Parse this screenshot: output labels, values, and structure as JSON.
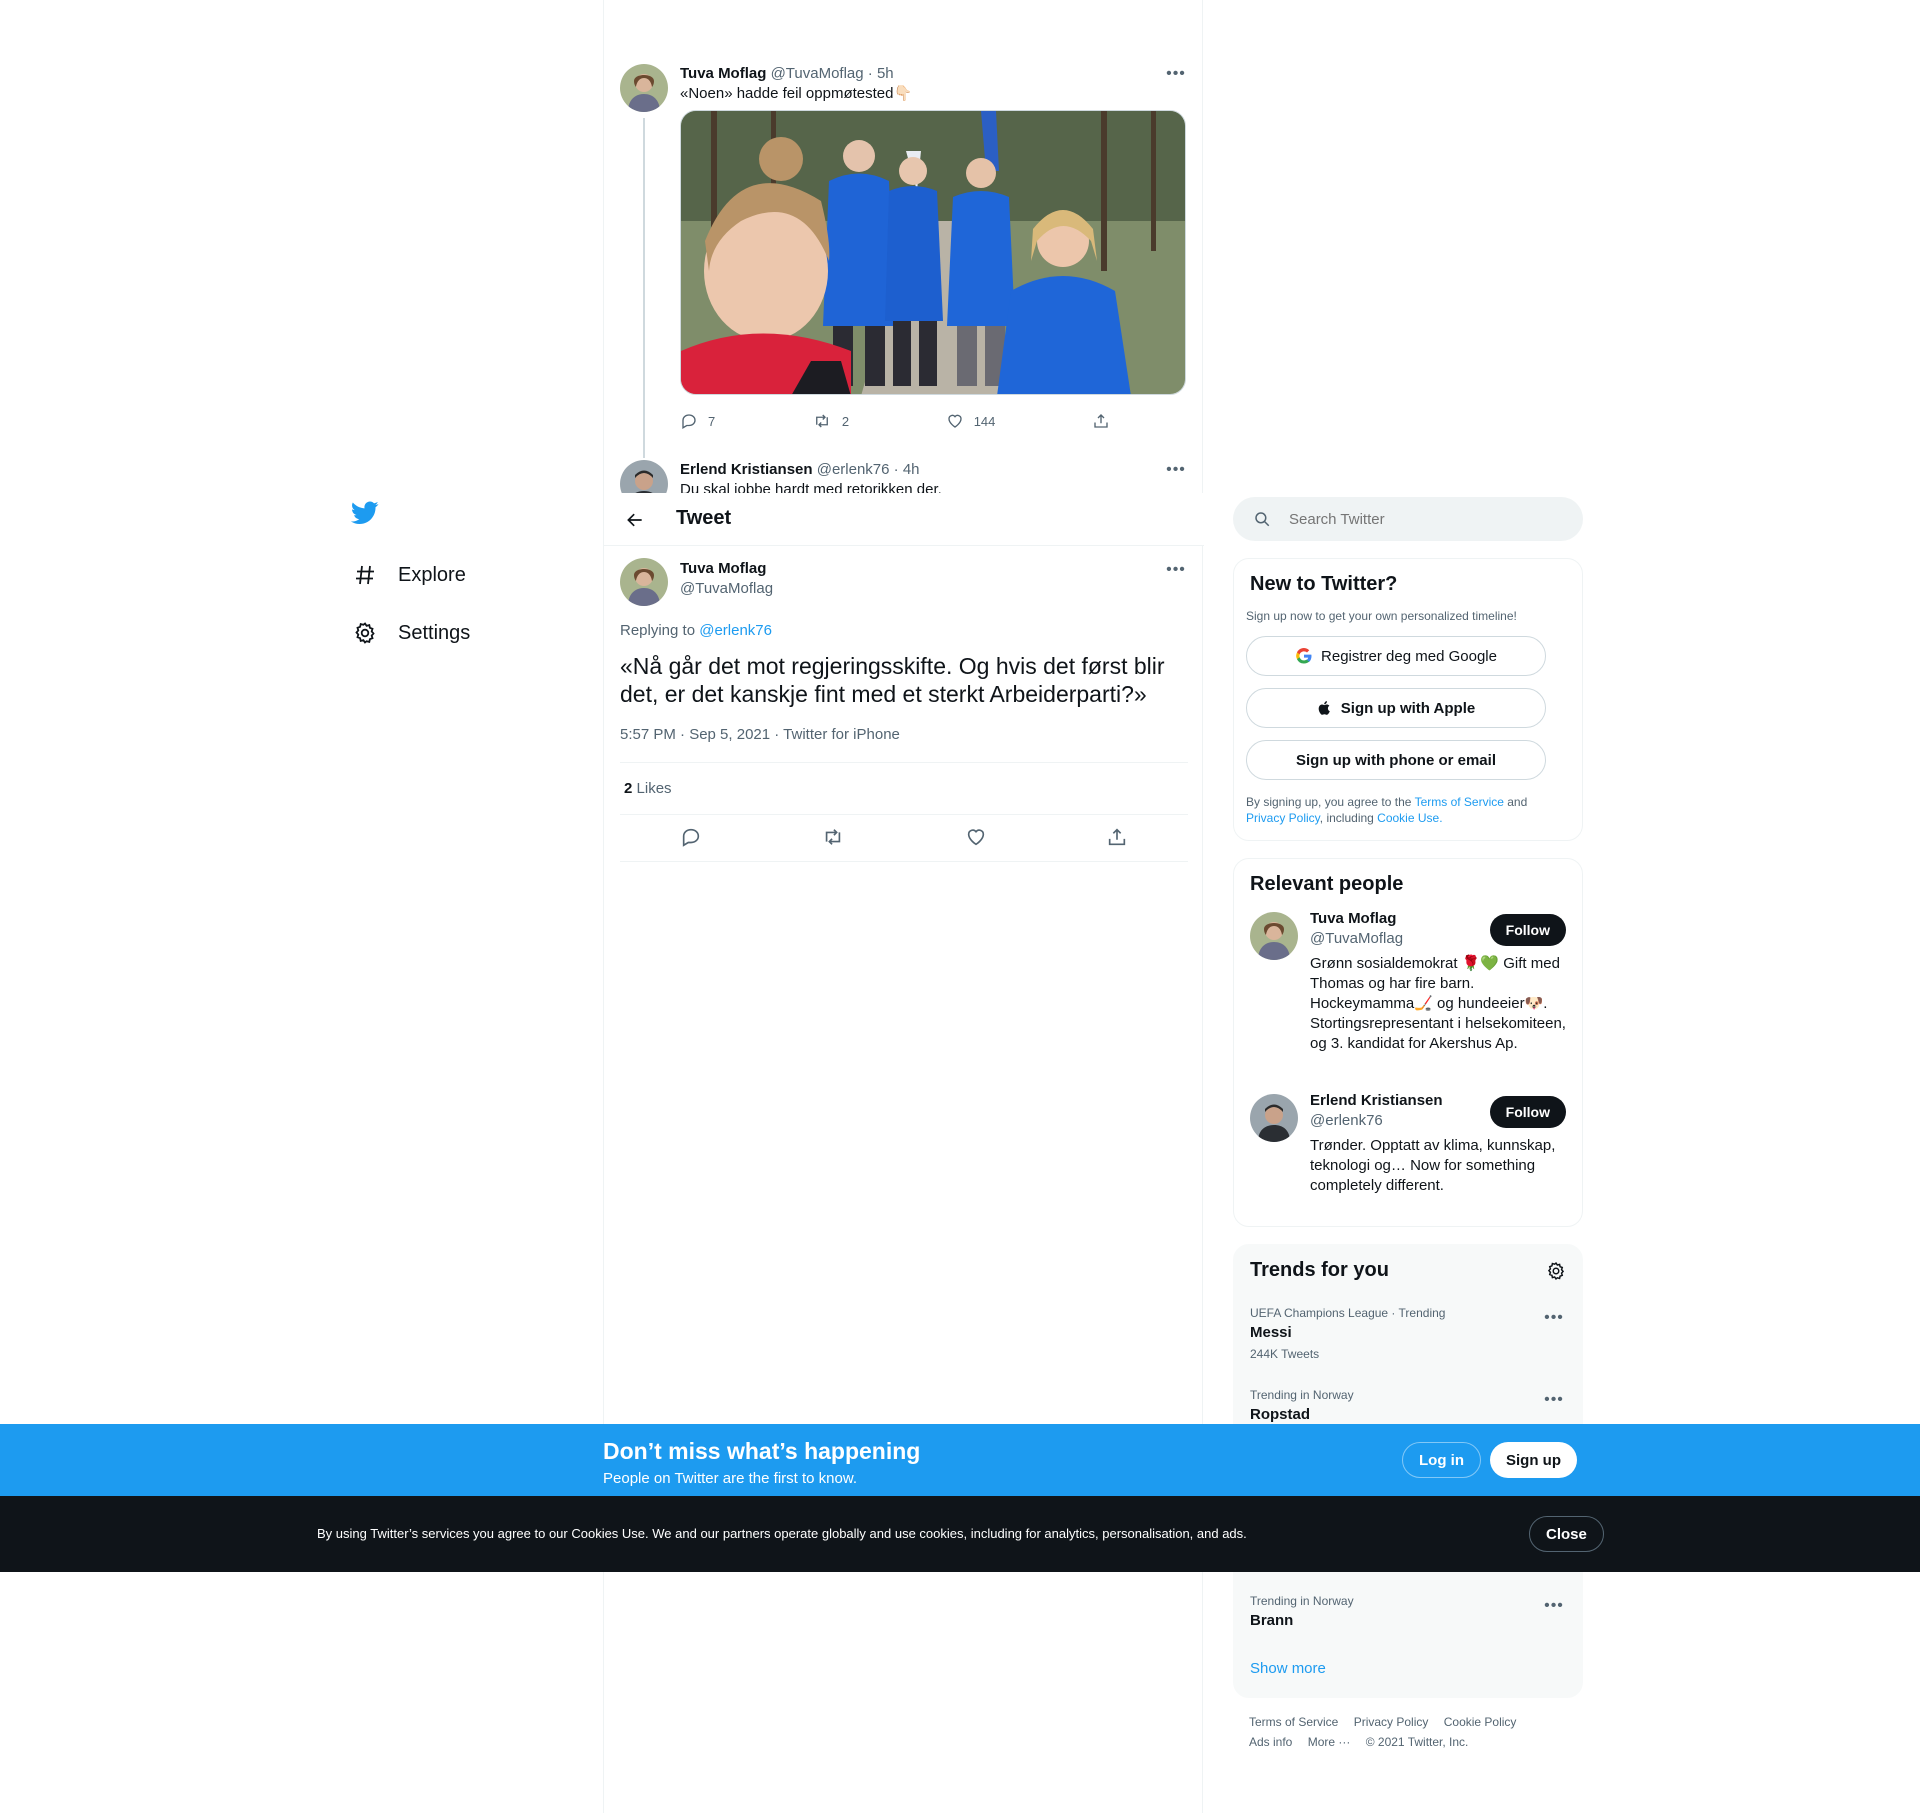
{
  "colors": {
    "brand": "#1d9bf0",
    "text": "#0f1419",
    "secondary": "#536471",
    "border": "#eff3f4",
    "dark_bar": "#0f1419"
  },
  "nav": {
    "logo_icon": "twitter-bird-icon",
    "items": [
      {
        "label": "Explore",
        "icon": "hashtag-icon"
      },
      {
        "label": "Settings",
        "icon": "gear-icon"
      }
    ]
  },
  "thread": {
    "tweet1": {
      "name": "Tuva Moflag",
      "handle": "@TuvaMoflag",
      "time": "· 5h",
      "text": "«Noen» hadde feil oppmøtested👇🏻",
      "replies": "7",
      "retweets": "2",
      "likes": "144"
    },
    "tweet2": {
      "name": "Erlend Kristiansen",
      "handle": "@erlenk76",
      "time": "· 4h",
      "text": "Du skal jobbe hardt med retorikken der."
    }
  },
  "header": {
    "title": "Tweet"
  },
  "focal": {
    "name": "Tuva Moflag",
    "handle": "@TuvaMoflag",
    "replying_prefix": "Replying to ",
    "replying_to": "@erlenk76",
    "text": "«Nå går det mot regjeringsskifte. Og hvis det først blir det, er det kanskje fint med et sterkt Arbeiderparti?»",
    "meta": "5:57 PM · Sep 5, 2021 · Twitter for iPhone",
    "likes_count": "2",
    "likes_label": "Likes"
  },
  "sidebar": {
    "search_placeholder": "Search Twitter",
    "new_to": {
      "title": "New to Twitter?",
      "subtitle": "Sign up now to get your own personalized timeline!",
      "google": "Registrer deg med Google",
      "apple": "Sign up with Apple",
      "phone": "Sign up with phone or email",
      "legal_1": "By signing up, you agree to the ",
      "terms": "Terms of Service",
      "legal_2": " and ",
      "privacy": "Privacy Policy",
      "legal_3": ", including ",
      "cookie": "Cookie Use."
    },
    "relevant": {
      "title": "Relevant people",
      "people": [
        {
          "name": "Tuva Moflag",
          "handle": "@TuvaMoflag",
          "bio": "Grønn sosialdemokrat 🌹💚 Gift med Thomas og har fire barn. Hockeymamma🏒 og hundeeier🐶. Stortingsrepresentant i helsekomiteen, og 3. kandidat for Akershus Ap.",
          "follow": "Follow"
        },
        {
          "name": "Erlend Kristiansen",
          "handle": "@erlenk76",
          "bio": "Trønder. Opptatt av klima, kunnskap, teknologi og… Now for something completely different.",
          "follow": "Follow"
        }
      ]
    },
    "trends": {
      "title": "Trends for you",
      "items": [
        {
          "meta": "UEFA Champions League · Trending",
          "name": "Messi",
          "count": "244K Tweets"
        },
        {
          "meta": "Trending in Norway",
          "name": "Ropstad",
          "count": ""
        },
        {
          "meta": "Trending in Norway",
          "name": "Brann",
          "count": ""
        }
      ],
      "show_more": "Show more"
    },
    "footer": {
      "links": [
        "Terms of Service",
        "Privacy Policy",
        "Cookie Policy",
        "Ads info",
        "More ···",
        "© 2021 Twitter, Inc."
      ]
    }
  },
  "banner": {
    "title": "Don’t miss what’s happening",
    "subtitle": "People on Twitter are the first to know.",
    "login": "Log in",
    "signup": "Sign up"
  },
  "cookie": {
    "text": "By using Twitter’s services you agree to our Cookies Use. We and our partners operate globally and use cookies, including for analytics, personalisation, and ads.",
    "close": "Close"
  }
}
